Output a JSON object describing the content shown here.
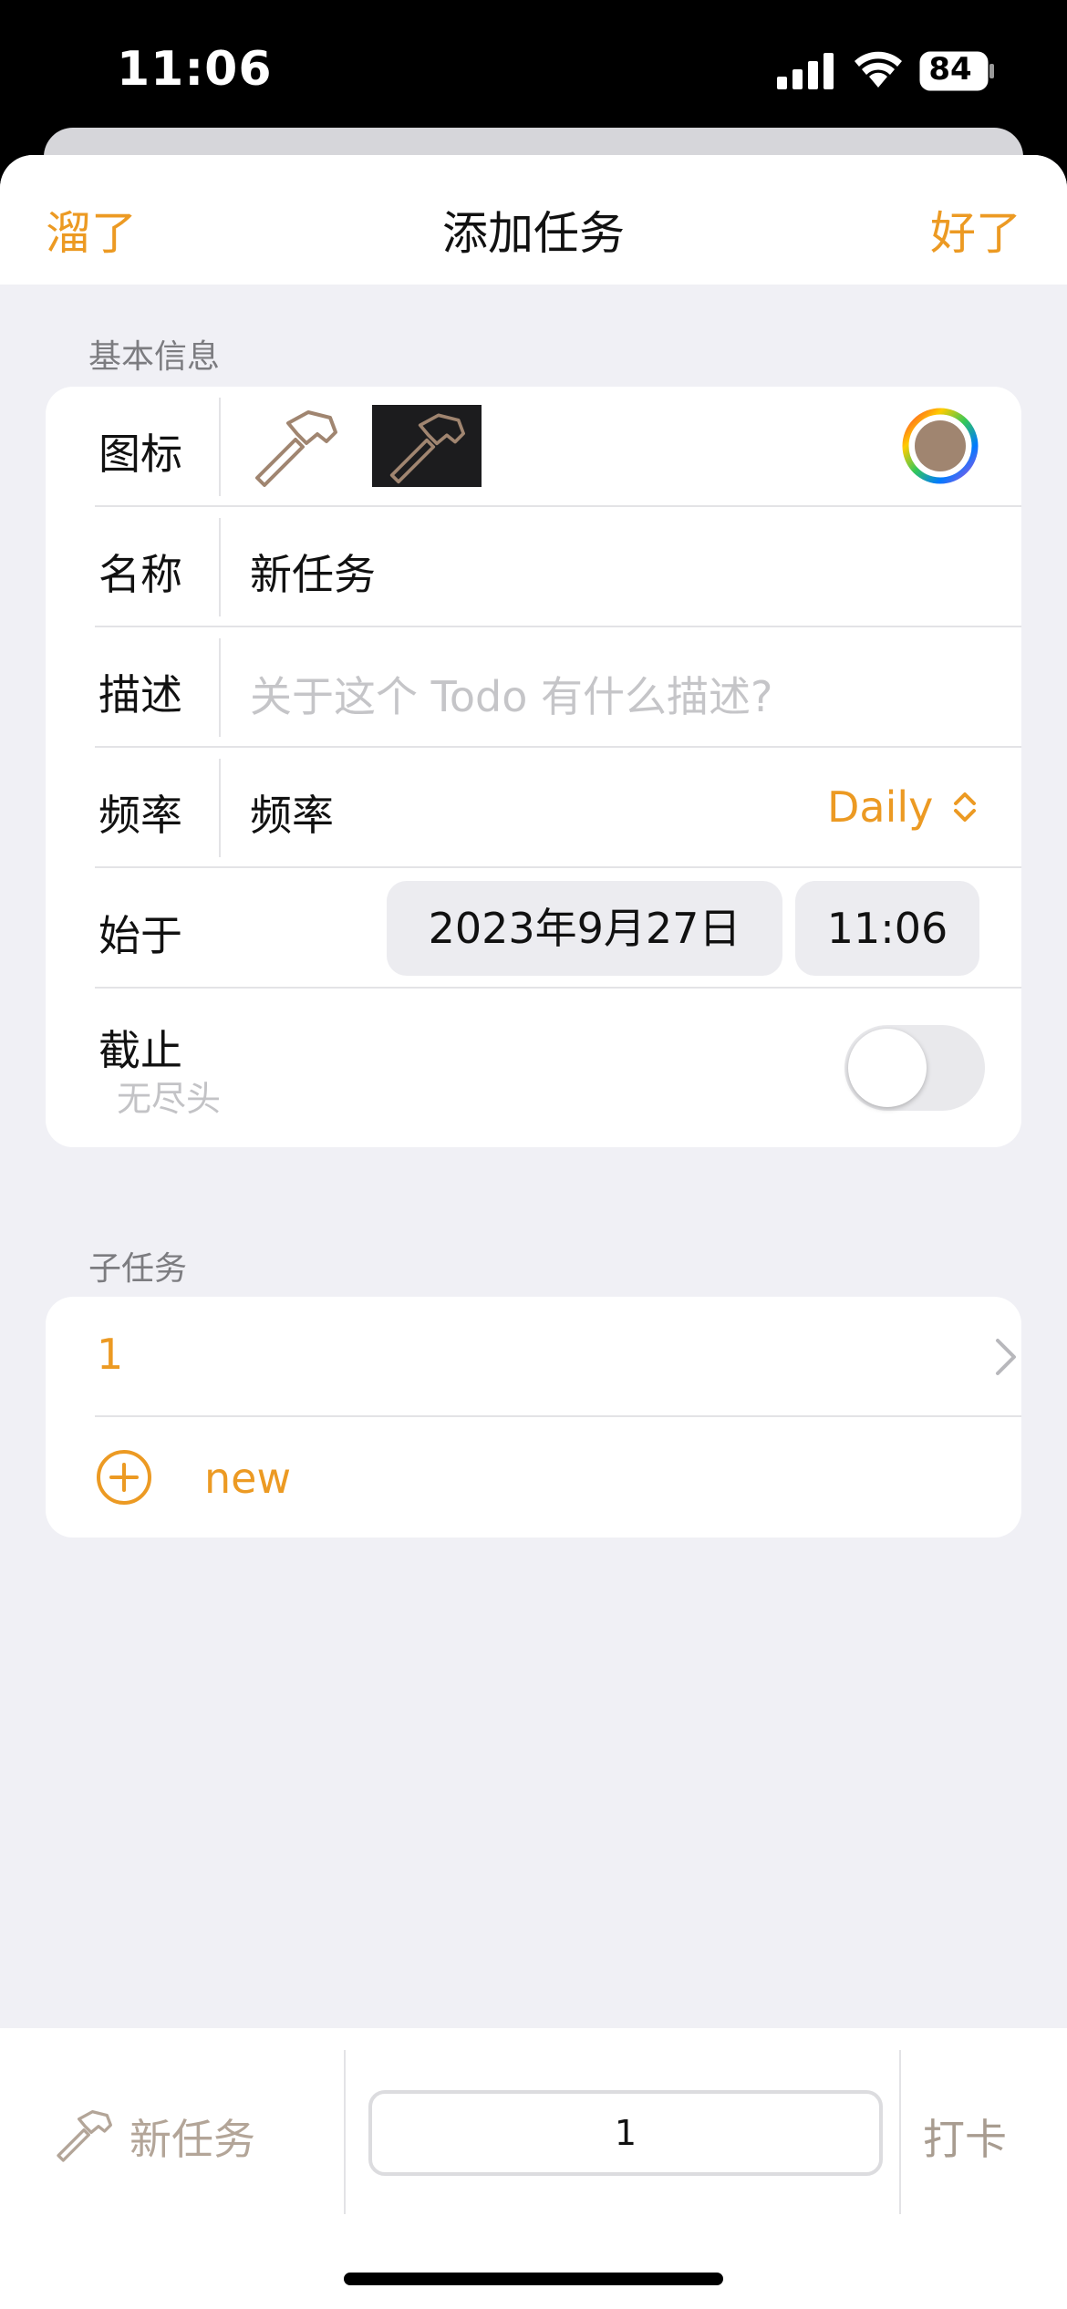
{
  "status_bar": {
    "time": "11:06",
    "battery": "84"
  },
  "nav": {
    "left_button": "溜了",
    "title": "添加任务",
    "right_button": "好了"
  },
  "basic_info": {
    "header": "基本信息",
    "icon_label": "图标",
    "name_label": "名称",
    "name_value": "新任务",
    "desc_label": "描述",
    "desc_placeholder": "关于这个 Todo 有什么描述?",
    "freq_label": "频率",
    "freq_value": "频率",
    "freq_option": "Daily",
    "start_label": "始于",
    "start_date": "2023年9月27日",
    "start_time": "11:06",
    "deadline_label": "截止",
    "deadline_sub": "无尽头",
    "deadline_enabled": false
  },
  "subtasks": {
    "header": "子任务",
    "items": [
      "1"
    ],
    "new_label": "new"
  },
  "bottom_bar": {
    "task_name": "新任务",
    "input_value": "1",
    "checkin_label": "打卡"
  },
  "colors": {
    "accent": "#ec9a23",
    "icon_brown": "#a08570",
    "background": "#f0f0f5"
  },
  "icons": [
    "hammer-icon",
    "color-wheel-icon",
    "chevron-updown-icon",
    "chevron-right-icon",
    "plus-circle-icon"
  ]
}
